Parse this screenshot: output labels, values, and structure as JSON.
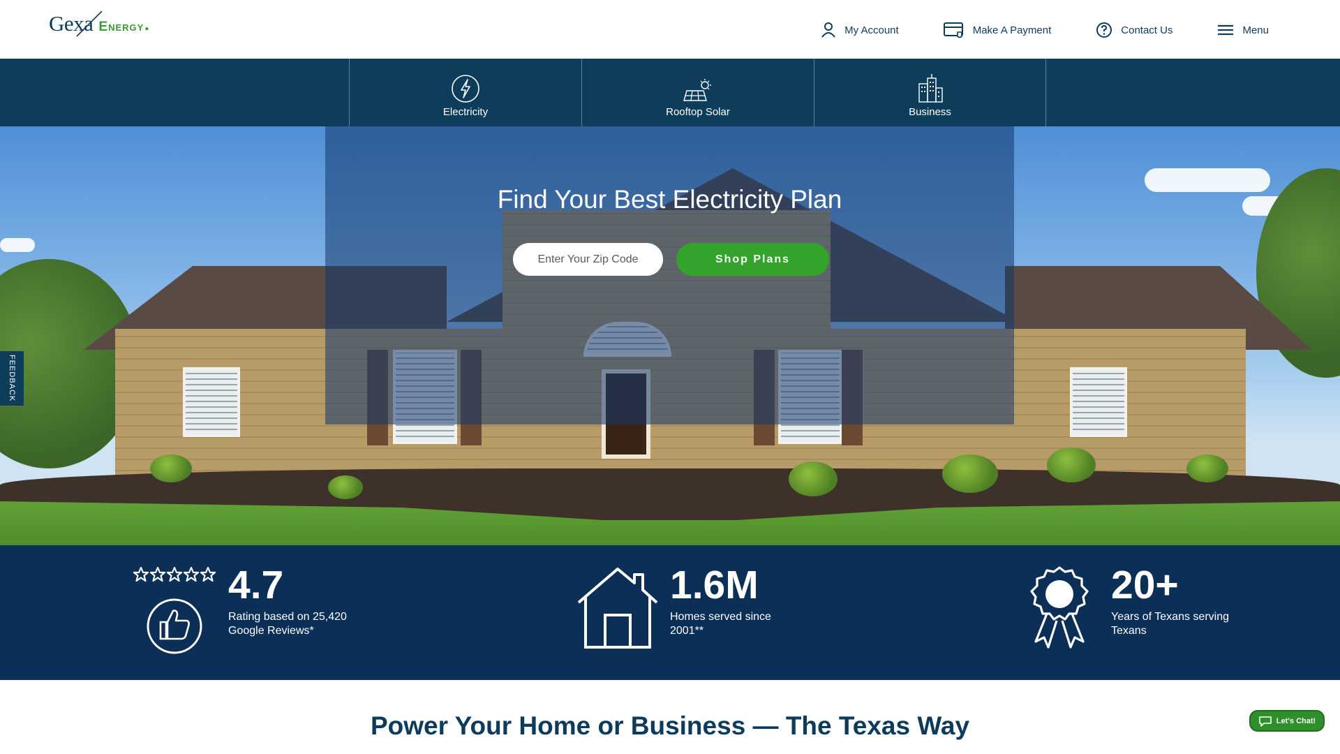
{
  "brand": {
    "name_part1": "Gexa",
    "name_part2": "Energy",
    "brand_green": "#3a9c2f",
    "brand_navy": "#0e3c5b"
  },
  "util_nav": [
    {
      "label": "My Account",
      "icon": "user-icon"
    },
    {
      "label": "Make A Payment",
      "icon": "credit-card-icon"
    },
    {
      "label": "Contact Us",
      "icon": "question-circle-icon"
    },
    {
      "label": "Menu",
      "icon": "hamburger-menu-icon"
    }
  ],
  "categories": [
    {
      "label": "Electricity",
      "icon": "lightning-bolt-icon"
    },
    {
      "label": "Rooftop Solar",
      "icon": "solar-panel-icon"
    },
    {
      "label": "Business",
      "icon": "buildings-icon"
    }
  ],
  "hero": {
    "title": "Find Your Best Electricity Plan",
    "zip_placeholder": "Enter Your Zip Code",
    "zip_value": "",
    "cta_label": "Shop Plans"
  },
  "feedback_label": "FEEDBACK",
  "stats": [
    {
      "value": "4.7",
      "desc": "Rating based on 25,420 Google Reviews*",
      "icon": "stars-thumbs-up-icon"
    },
    {
      "value": "1.6M",
      "desc": "Homes served since 2001**",
      "icon": "house-icon"
    },
    {
      "value": "20+",
      "desc": "Years of Texans serving Texans",
      "icon": "award-ribbon-icon"
    }
  ],
  "section_title": "Power Your Home or Business — The Texas Way",
  "chat_label": "Let's Chat!"
}
